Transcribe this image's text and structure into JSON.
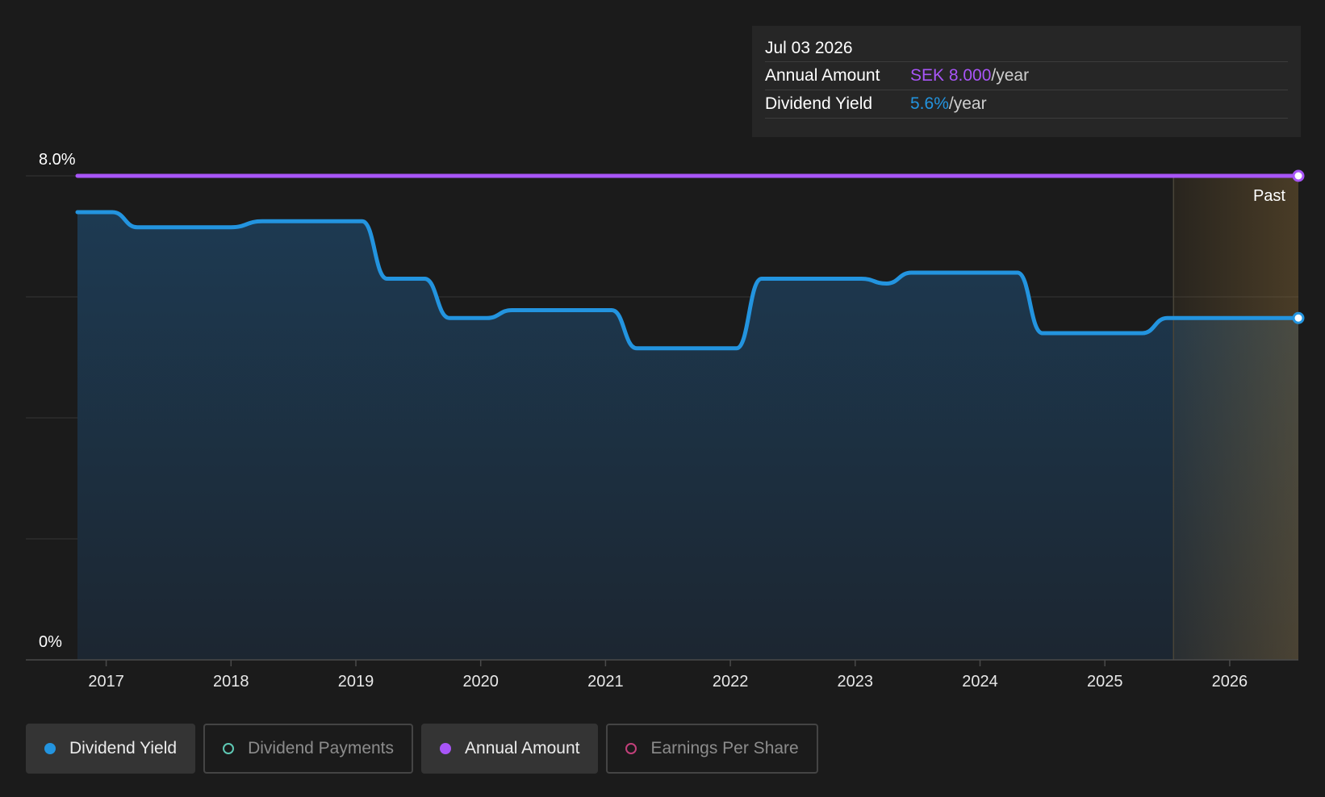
{
  "chart_data": {
    "type": "line",
    "y_axis": {
      "top_label": "8.0%",
      "bottom_label": "0%",
      "ylim": [
        0,
        8.0
      ],
      "gridlines": [
        0,
        2,
        4,
        6,
        8
      ]
    },
    "x_axis": {
      "ticks": [
        "2017",
        "2018",
        "2019",
        "2020",
        "2021",
        "2022",
        "2023",
        "2024",
        "2025",
        "2026"
      ],
      "xlim": [
        2016.77,
        2026.55
      ]
    },
    "past_region": {
      "label": "Past",
      "start": 2025.55,
      "end": 2026.55
    },
    "series": [
      {
        "name": "Dividend Yield",
        "color": "#2394df",
        "area": true,
        "points": [
          [
            2016.77,
            7.4
          ],
          [
            2017.05,
            7.4
          ],
          [
            2017.25,
            7.15
          ],
          [
            2018.0,
            7.15
          ],
          [
            2018.25,
            7.25
          ],
          [
            2019.05,
            7.25
          ],
          [
            2019.25,
            6.3
          ],
          [
            2019.55,
            6.3
          ],
          [
            2019.75,
            5.65
          ],
          [
            2020.05,
            5.65
          ],
          [
            2020.25,
            5.78
          ],
          [
            2021.05,
            5.78
          ],
          [
            2021.25,
            5.15
          ],
          [
            2022.05,
            5.15
          ],
          [
            2022.25,
            6.3
          ],
          [
            2023.05,
            6.3
          ],
          [
            2023.25,
            6.22
          ],
          [
            2023.45,
            6.4
          ],
          [
            2024.3,
            6.4
          ],
          [
            2024.5,
            5.4
          ],
          [
            2025.3,
            5.4
          ],
          [
            2025.5,
            5.65
          ],
          [
            2026.55,
            5.65
          ]
        ]
      },
      {
        "name": "Annual Amount",
        "color": "#a855f7",
        "area": false,
        "points": [
          [
            2016.77,
            8.0
          ],
          [
            2026.55,
            8.0
          ]
        ]
      }
    ]
  },
  "tooltip": {
    "date": "Jul 03 2026",
    "rows": [
      {
        "label": "Annual Amount",
        "value": "SEK 8.000",
        "unit": "/year",
        "color": "#a855f7"
      },
      {
        "label": "Dividend Yield",
        "value": "5.6%",
        "unit": "/year",
        "color": "#2394df"
      }
    ]
  },
  "legend": [
    {
      "label": "Dividend Yield",
      "color": "#2394df",
      "active": true,
      "marker": "filled"
    },
    {
      "label": "Dividend Payments",
      "color": "#5ec8b4",
      "active": false,
      "marker": "hollow"
    },
    {
      "label": "Annual Amount",
      "color": "#a855f7",
      "active": true,
      "marker": "filled"
    },
    {
      "label": "Earnings Per Share",
      "color": "#c2407a",
      "active": false,
      "marker": "hollow"
    }
  ]
}
